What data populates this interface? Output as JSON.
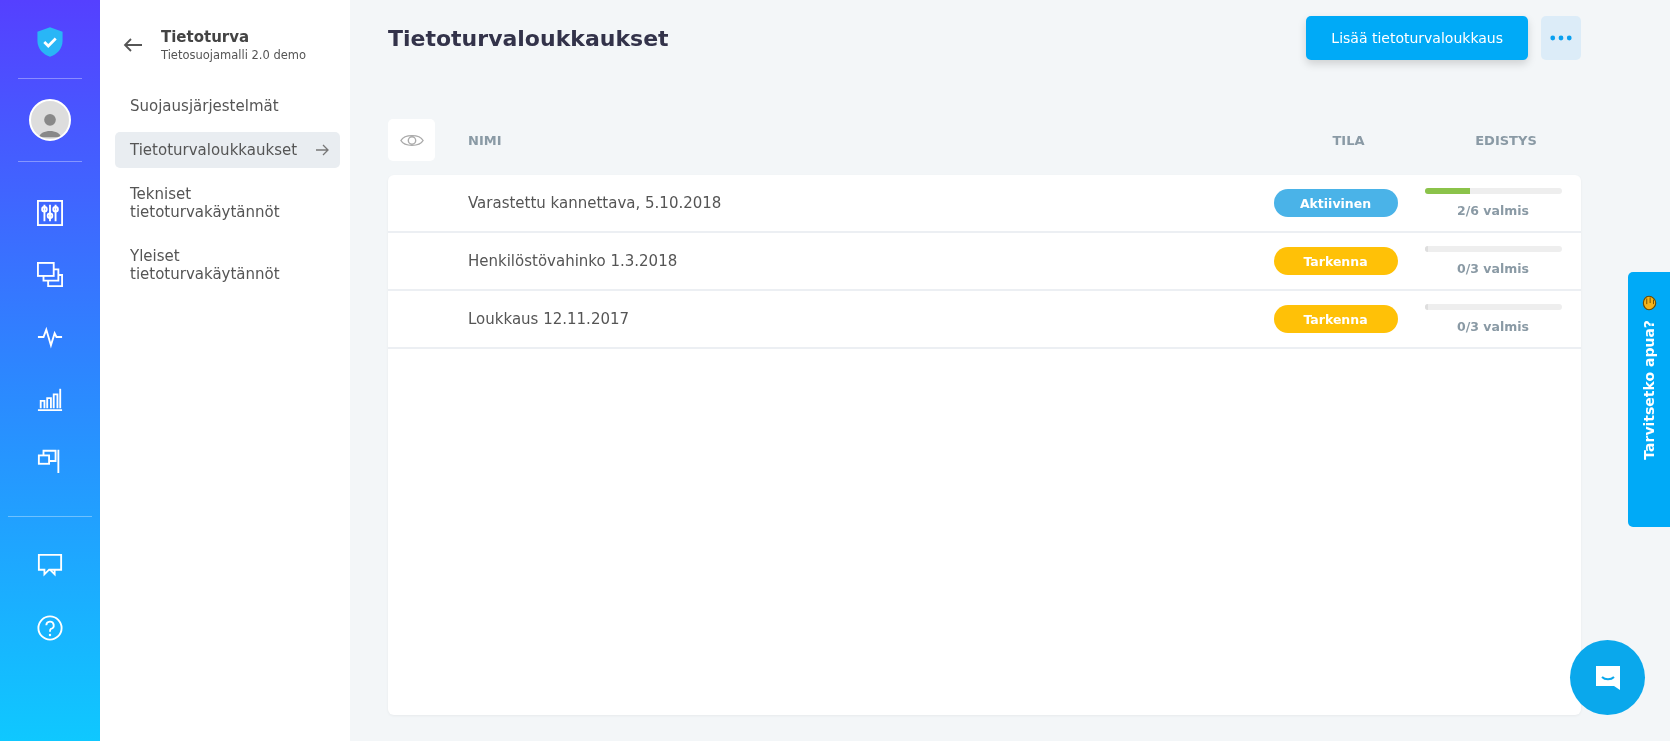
{
  "rail": {
    "items": [
      {
        "kind": "sliders",
        "selected": false
      },
      {
        "kind": "stack",
        "selected": false
      },
      {
        "kind": "pulse",
        "selected": false
      },
      {
        "kind": "chart",
        "selected": false
      },
      {
        "kind": "flag",
        "selected": false
      }
    ],
    "bottom": [
      {
        "kind": "chat"
      },
      {
        "kind": "help"
      }
    ]
  },
  "sidebar": {
    "title": "Tietoturva",
    "subtitle": "Tietosuojamalli 2.0 demo",
    "items": [
      {
        "label": "Suojausjärjestelmät",
        "selected": false
      },
      {
        "label": "Tietoturvaloukkaukset",
        "selected": true
      },
      {
        "label": "Tekniset tietoturvakäytännöt",
        "selected": false
      },
      {
        "label": "Yleiset tietoturvakäytännöt",
        "selected": false
      }
    ]
  },
  "page": {
    "title": "Tietoturvaloukkaukset",
    "primary_button": "Lisää tietoturvaloukkaus"
  },
  "table": {
    "columns": [
      "NIMI",
      "TILA",
      "EDISTYS"
    ],
    "rows": [
      {
        "name": "Varastettu kannettava, 5.10.2018",
        "status": "Aktiivinen",
        "color": "#4ab3e8",
        "level": 0.33,
        "progress": "2/6 valmis"
      },
      {
        "name": "Henkilöstövahinko 1.3.2018",
        "status": "Tarkenna",
        "color": "#ffc107",
        "level": 0,
        "progress": "0/3 valmis"
      },
      {
        "name": "Loukkaus 12.11.2017",
        "status": "Tarkenna",
        "color": "#ffc107",
        "level": 0,
        "progress": "0/3 valmis"
      }
    ]
  },
  "help_tab": {
    "label": "Tarvitsetko apua?"
  }
}
